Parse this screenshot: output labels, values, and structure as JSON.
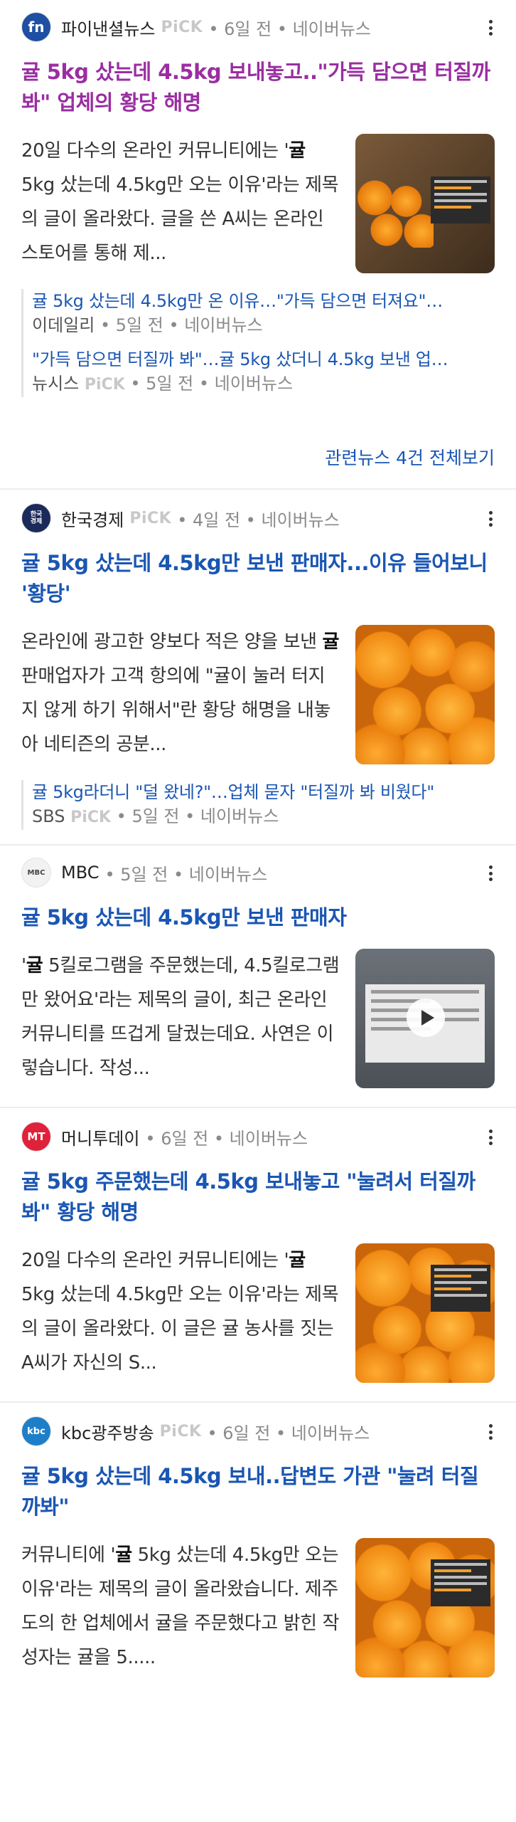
{
  "articles": [
    {
      "press": "파이낸셜뉴스",
      "pick": "PiCK",
      "meta": "• 6일 전 • 네이버뉴스",
      "logo_text": "fn",
      "logo_color": "#1f4fa3",
      "headline_bold": "귤 5kg 샀는데 4.5kg 보내놓고..\"가득 담으면 터질까봐\" 업체의 황당 해명",
      "headline_color": "#9a2ea1",
      "summary_a": "20일 다수의 온라인 커뮤니티에는 '",
      "summary_b": "귤",
      "summary_c": " 5kg 샀는데 4.5kg만 오는 이유'라는 제목의 글이 올라왔다. 글을 쓴 A씨는 온라인 스토어를 통해 제...",
      "related": [
        {
          "title": "귤 5kg 샀는데 4.5kg만 온 이유…\"가득 담으면 터져요\"…",
          "press": "이데일리",
          "pick": "",
          "meta": "• 5일 전 • 네이버뉴스"
        },
        {
          "title": "\"가득 담으면 터질까 봐\"…귤 5kg 샀더니 4.5kg 보낸 업…",
          "press": "뉴시스",
          "pick": "PiCK",
          "meta": "• 5일 전 • 네이버뉴스"
        }
      ],
      "see_all": "관련뉴스 4건 전체보기"
    },
    {
      "press": "한국경제",
      "pick": "PiCK",
      "meta": "• 4일 전 • 네이버뉴스",
      "logo_text": "한국경제",
      "logo_color": "#1b2a5a",
      "headline_bold": "귤 5kg 샀는데 4.5kg만 보낸 판매자...이유 들어보니 '황당'",
      "headline_color": "#1a56b3",
      "summary_a": "온라인에 광고한 양보다 적은 양을 보낸 ",
      "summary_b": "귤",
      "summary_c": " 판매업자가 고객 항의에 \"귤이 눌러 터지지 않게 하기 위해서\"란 황당 해명을 내놓아 네티즌의 공분...",
      "related": [
        {
          "title": "귤 5kg라더니 \"덜 왔네?\"…업체 묻자 \"터질까 봐 비웠다\"",
          "press": "SBS",
          "pick": "PiCK",
          "meta": "• 5일 전 • 네이버뉴스"
        }
      ]
    },
    {
      "press": "MBC",
      "pick": "",
      "meta": "• 5일 전 • 네이버뉴스",
      "logo_text": "MBC",
      "logo_color": "#f2f2f2",
      "headline_bold": "귤 5kg 샀는데 4.5kg만 보낸 판매자",
      "headline_color": "#1a56b3",
      "summary_a": "'",
      "summary_b": "귤",
      "summary_c": " 5킬로그램을 주문했는데, 4.5킬로그램만 왔어요'라는 제목의 글이, 최근 온라인 커뮤니티를 뜨겁게 달궜는데요. 사연은 이렇습니다. 작성..."
    },
    {
      "press": "머니투데이",
      "pick": "",
      "meta": "• 6일 전 • 네이버뉴스",
      "logo_text": "MT",
      "logo_color": "#e0213a",
      "headline_bold": "귤 5kg 주문했는데 4.5kg 보내놓고 \"눌려서 터질까봐\" 황당 해명",
      "headline_color": "#1a56b3",
      "summary_a": "20일 다수의 온라인 커뮤니티에는 '",
      "summary_b": "귤",
      "summary_c": " 5kg 샀는데 4.5kg만 오는 이유'라는 제목의 글이 올라왔다. 이 글은 귤 농사를 짓는 A씨가 자신의 S..."
    },
    {
      "press": "kbc광주방송",
      "pick": "PiCK",
      "meta": "• 6일 전 • 네이버뉴스",
      "logo_text": "kbc",
      "logo_color": "#1e7fc8",
      "headline_bold": "귤 5kg 샀는데 4.5kg 보내..답변도 가관 \"눌려 터질까봐\"",
      "headline_color": "#1a56b3",
      "summary_a": "커뮤니티에 '",
      "summary_b": "귤",
      "summary_c": " 5kg 샀는데 4.5kg만 오는 이유'라는 제목의 글이 올라왔습니다. 제주도의 한 업체에서 귤을 주문했다고 밝힌 작성자는 귤을 5....."
    }
  ]
}
